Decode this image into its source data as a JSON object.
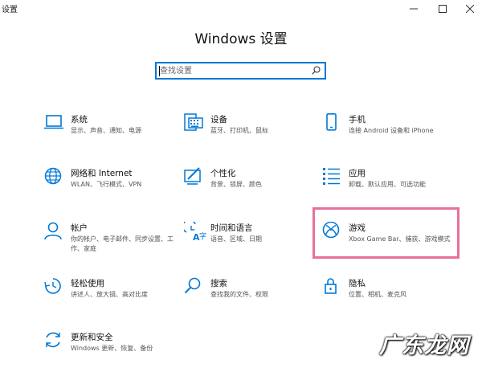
{
  "window": {
    "title": "设置"
  },
  "page": {
    "title": "Windows 设置"
  },
  "search": {
    "placeholder": "查找设置"
  },
  "tiles": [
    {
      "name": "系统",
      "desc": "显示、声音、通知、电源",
      "icon": "laptop-icon"
    },
    {
      "name": "设备",
      "desc": "蓝牙、打印机、鼠标",
      "icon": "keyboard-icon"
    },
    {
      "name": "手机",
      "desc": "连接 Android 设备和 iPhone",
      "icon": "phone-icon"
    },
    {
      "name": "网络和 Internet",
      "desc": "WLAN、飞行模式、VPN",
      "icon": "globe-icon"
    },
    {
      "name": "个性化",
      "desc": "背景、锁屏、颜色",
      "icon": "paint-icon"
    },
    {
      "name": "应用",
      "desc": "卸载、默认应用、可选功能",
      "icon": "apps-list-icon"
    },
    {
      "name": "帐户",
      "desc": "你的帐户、电子邮件、同步设置、工作、家庭",
      "icon": "person-icon"
    },
    {
      "name": "时间和语言",
      "desc": "语音、区域、日期",
      "icon": "time-language-icon"
    },
    {
      "name": "游戏",
      "desc": "Xbox Game Bar、捕获、游戏模式",
      "icon": "xbox-icon"
    },
    {
      "name": "轻松使用",
      "desc": "讲述人、放大镜、高对比度",
      "icon": "ease-of-access-icon"
    },
    {
      "name": "搜索",
      "desc": "查找我的文件、权限",
      "icon": "search-icon"
    },
    {
      "name": "隐私",
      "desc": "位置、相机、麦克风",
      "icon": "lock-icon"
    },
    {
      "name": "更新和安全",
      "desc": "Windows 更新、恢复、备份",
      "icon": "sync-icon"
    }
  ],
  "colors": {
    "accent": "#0078d7",
    "highlight": "#e8709a"
  },
  "watermark": "广东龙网"
}
